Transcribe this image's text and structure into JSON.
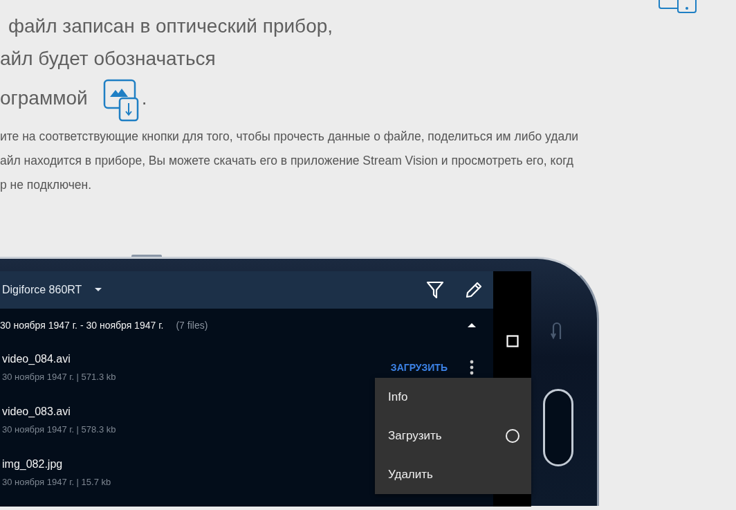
{
  "intro_lines": [
    "файл записан в оптический прибор,",
    "айл будет обозначаться"
  ],
  "intro_icon_line": {
    "text": "ограммой",
    "after": "."
  },
  "paragraph_lines": [
    "ите на соответствующие кнопки для того, чтобы прочесть данные о файле, поделиться им либо удали",
    "айл находится в приборе, Вы можете скачать его в приложение Stream Vision и просмотреть его, когд",
    "р не подключен."
  ],
  "app": {
    "device": "Digiforce 860RT",
    "group": {
      "title": "30 ноября 1947 г. - 30 ноября 1947 г.",
      "count": "(7 files)",
      "expanded": true
    },
    "files": [
      {
        "name": "video_084.avi",
        "meta": "30 ноября 1947 г. | 571.3 kb",
        "action": "ЗАГРУЗИТЬ"
      },
      {
        "name": "video_083.avi",
        "meta": "30 ноября 1947 г. | 578.3 kb"
      },
      {
        "name": "img_082.jpg",
        "meta": "30 ноября 1947 г. | 15.7 kb"
      }
    ],
    "menu": [
      {
        "label": "Info",
        "kind": "plain"
      },
      {
        "label": "Загрузить",
        "kind": "radio",
        "selected": false
      },
      {
        "label": "Удалить",
        "kind": "plain"
      }
    ]
  }
}
